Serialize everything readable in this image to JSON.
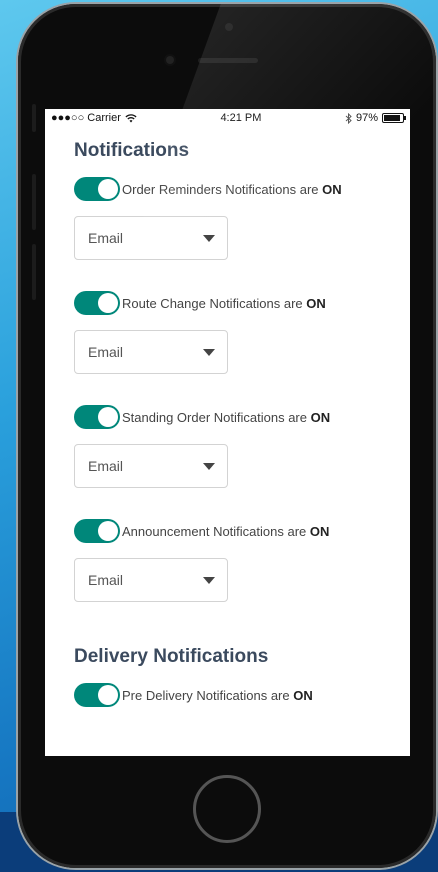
{
  "status_bar": {
    "carrier": "●●●○○ Carrier",
    "wifi_icon": "wifi-icon",
    "time": "4:21 PM",
    "bluetooth_icon": "bluetooth-icon",
    "battery": "97%"
  },
  "sections": [
    {
      "title": "Notifications",
      "items": [
        {
          "label": "Order Reminders Notifications are",
          "state": "ON",
          "select_value": "Email"
        },
        {
          "label": "Route Change Notifications are",
          "state": "ON",
          "select_value": "Email"
        },
        {
          "label": "Standing Order Notifications are",
          "state": "ON",
          "select_value": "Email"
        },
        {
          "label": "Announcement Notifications are",
          "state": "ON",
          "select_value": "Email"
        }
      ]
    },
    {
      "title": "Delivery Notifications",
      "items": [
        {
          "label": "Pre Delivery Notifications are",
          "state": "ON"
        }
      ]
    }
  ],
  "colors": {
    "toggle_on": "#00877a",
    "title": "#3b4a5e"
  }
}
